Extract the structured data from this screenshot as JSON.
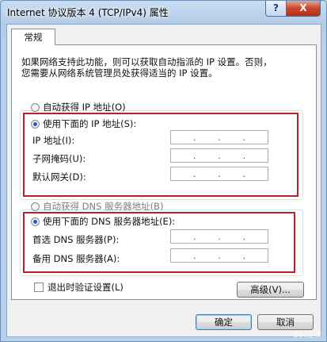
{
  "window": {
    "title": "Internet 协议版本 4 (TCP/IPv4) 属性",
    "help_label": "?",
    "close_label": "X"
  },
  "tab": {
    "label": "常规"
  },
  "description": [
    "如果网络支持此功能，则可以获取自动指派的 IP 设置。否则，",
    "您需要从网络系统管理员处获得适当的 IP 设置。"
  ],
  "ip_section": {
    "auto_label": "自动获得 IP 地址(O)",
    "manual_label": "使用下面的 IP 地址(S):",
    "manual_selected": true,
    "fields": [
      {
        "label": "IP 地址(I):",
        "value": ". . ."
      },
      {
        "label": "子网掩码(U):",
        "value": ". . ."
      },
      {
        "label": "默认网关(D):",
        "value": ". . ."
      }
    ]
  },
  "dns_section": {
    "auto_label": "自动获得 DNS 服务器地址(B)",
    "manual_label": "使用下面的 DNS 服务器地址(E):",
    "manual_selected": true,
    "fields": [
      {
        "label": "首选 DNS 服务器(P):",
        "value": ". . ."
      },
      {
        "label": "备用 DNS 服务器(A):",
        "value": ". . ."
      }
    ]
  },
  "validate_on_exit": {
    "label": "退出时验证设置(L)",
    "checked": false
  },
  "buttons": {
    "advanced": "高级(V)...",
    "ok": "确定",
    "cancel": "取消"
  },
  "watermark": "Bai经验",
  "colors": {
    "highlight": "#b8212a",
    "title_bar": "#b9d1ea",
    "close_button": "#c9452a"
  }
}
